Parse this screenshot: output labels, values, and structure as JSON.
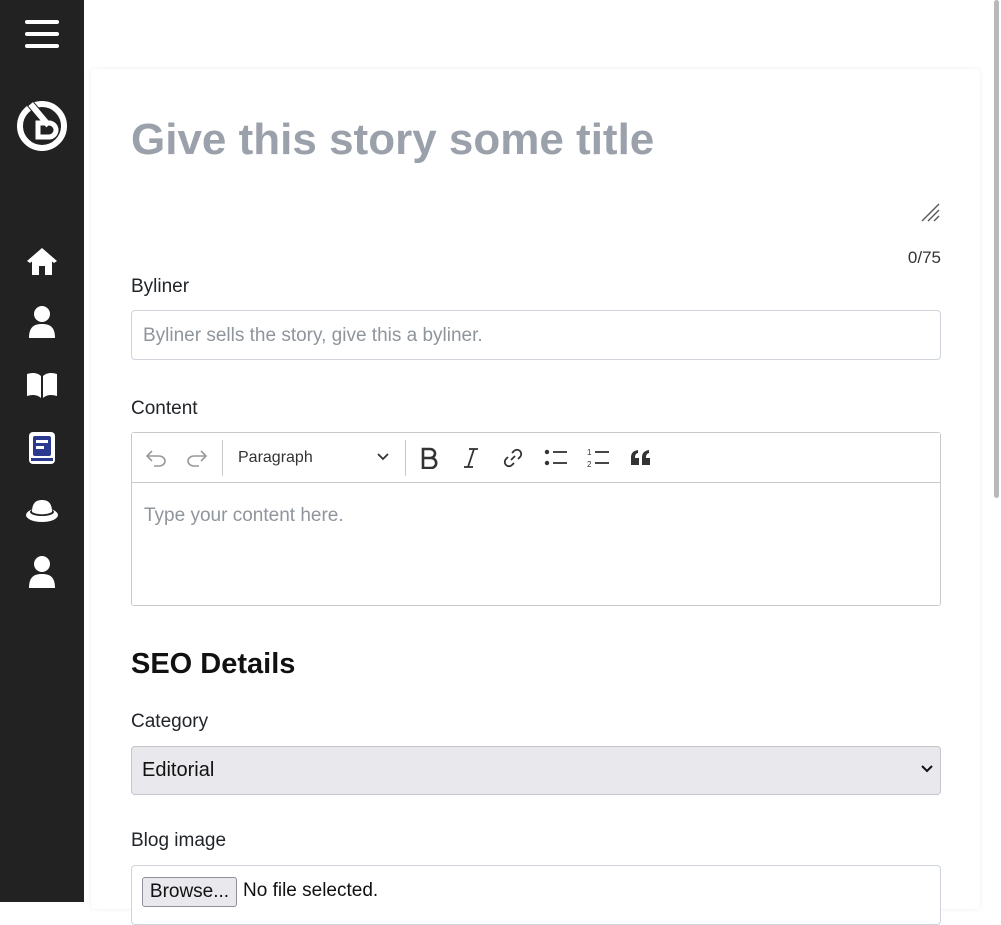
{
  "sidebar": {
    "items": [
      {
        "name": "menu-icon"
      },
      {
        "name": "logo-icon"
      },
      {
        "name": "home-icon"
      },
      {
        "name": "user-icon"
      },
      {
        "name": "book-open-icon"
      },
      {
        "name": "book-icon",
        "active": true
      },
      {
        "name": "hat-icon"
      },
      {
        "name": "user-icon"
      }
    ],
    "colors": {
      "background": "#222222",
      "icon": "#ffffff",
      "active_accent": "#2b3a8f"
    }
  },
  "story": {
    "title_placeholder": "Give this story some title",
    "title_counter": "0/75",
    "byliner_label": "Byliner",
    "byliner_placeholder": "Byliner sells the story, give this a byliner.",
    "content_label": "Content",
    "content_placeholder": "Type your content here."
  },
  "editor_toolbar": {
    "buttons": [
      "undo-icon",
      "redo-icon",
      "bold-icon",
      "italic-icon",
      "link-icon",
      "bulleted-list-icon",
      "numbered-list-icon",
      "quote-icon"
    ],
    "heading_select_value": "Paragraph"
  },
  "seo": {
    "heading": "SEO Details",
    "category_label": "Category",
    "category_value": "Editorial",
    "blog_image_label": "Blog image",
    "browse_label": "Browse...",
    "file_status": "No file selected."
  }
}
